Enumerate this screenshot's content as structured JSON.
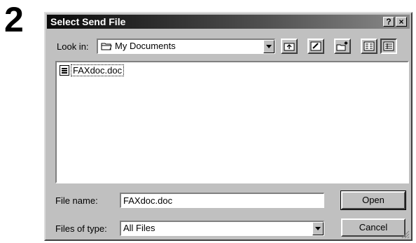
{
  "step_number": "2",
  "dialog": {
    "title": "Select Send File",
    "help_button": "?",
    "close_button": "×"
  },
  "look_in": {
    "label": "Look in:",
    "label_underline_char": "i",
    "value": "My Documents"
  },
  "toolbar_icons": [
    "up-folder-icon",
    "desktop-icon",
    "new-folder-icon",
    "list-view-icon",
    "details-view-icon"
  ],
  "files": [
    {
      "name": "FAXdoc.doc",
      "icon": "document-icon",
      "selected": true
    }
  ],
  "file_name": {
    "label": "File name:",
    "value": "FAXdoc.doc"
  },
  "files_of_type": {
    "label": "Files of type:",
    "value": "All Files"
  },
  "buttons": {
    "open": "Open",
    "cancel": "Cancel"
  }
}
